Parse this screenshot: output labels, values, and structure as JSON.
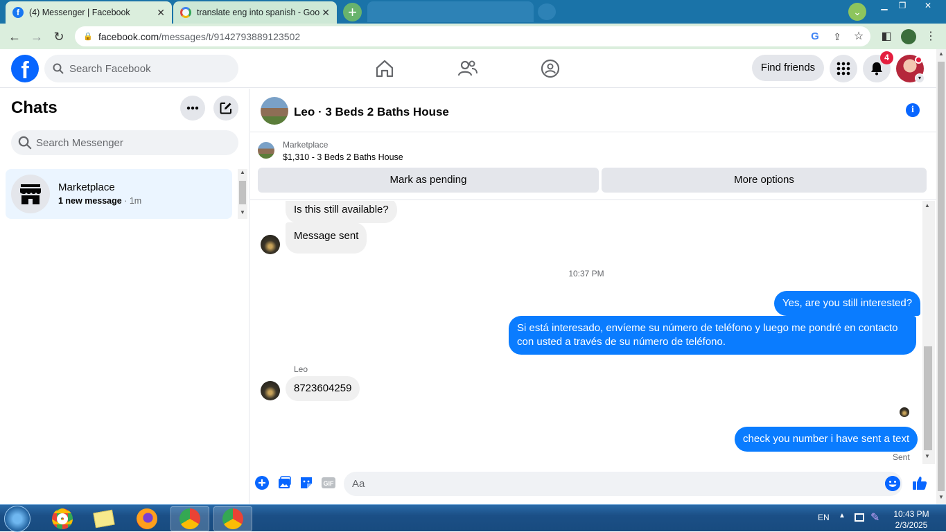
{
  "browser": {
    "tabs": [
      {
        "title": "(4) Messenger | Facebook",
        "active": true
      },
      {
        "title": "translate eng into spanish - Goo",
        "active": false
      }
    ],
    "url_domain": "facebook.com",
    "url_path": "/messages/t/9142793889123502"
  },
  "fb_header": {
    "search_placeholder": "Search Facebook",
    "find_friends": "Find friends",
    "notification_count": "4"
  },
  "sidebar": {
    "title": "Chats",
    "search_placeholder": "Search Messenger",
    "chat": {
      "name": "Marketplace",
      "new_message": "1 new message",
      "time": "1m"
    }
  },
  "conversation": {
    "title": "Leo · 3 Beds 2 Baths House",
    "listing": {
      "category": "Marketplace",
      "description": "$1,310 - 3 Beds 2 Baths House",
      "mark_pending": "Mark as pending",
      "more_options": "More options"
    },
    "messages": {
      "m1": "Is this still available?",
      "m2": "Message sent",
      "timestamp": "10:37 PM",
      "m3": "Yes, are you still interested?",
      "m4": "Si está interesado, envíeme su número de teléfono y luego me pondré en contacto con usted a través de su número de teléfono.",
      "sender_name": "Leo",
      "m5": "8723604259",
      "m6": "check you number i have sent a text",
      "status": "Sent"
    },
    "composer_placeholder": "Aa"
  },
  "taskbar": {
    "lang": "EN",
    "time": "10:43 PM",
    "date": "2/3/2025"
  },
  "colors": {
    "fb_blue": "#0866ff",
    "outgoing_bubble": "#0a7cff",
    "incoming_bubble": "#f0f0f0",
    "chrome_bar": "#dbeedd"
  },
  "icons": [
    "facebook-icon",
    "google-icon",
    "home-icon",
    "friends-icon",
    "groups-icon",
    "menu-grid-icon",
    "bell-icon",
    "more-icon",
    "compose-icon",
    "search-icon",
    "store-icon",
    "info-icon",
    "plus-icon",
    "image-icon",
    "sticker-icon",
    "gif-icon",
    "emoji-icon",
    "like-icon"
  ]
}
